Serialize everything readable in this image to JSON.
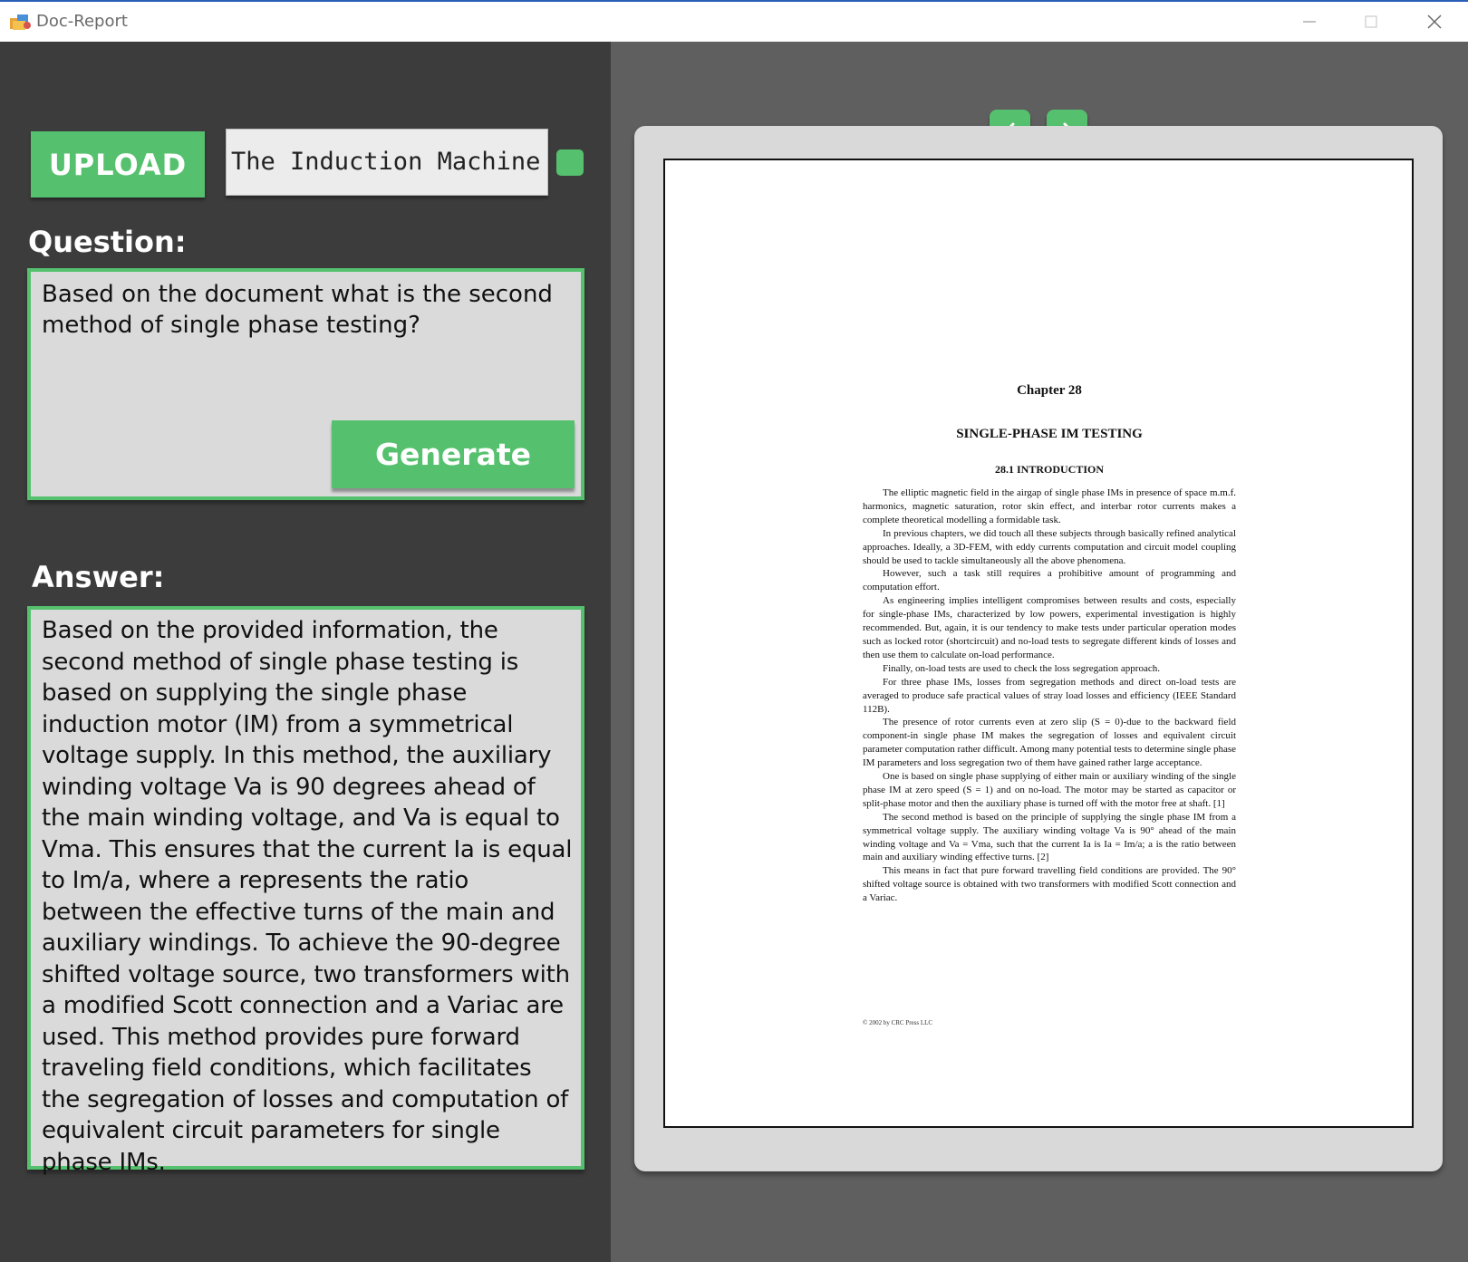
{
  "window": {
    "title": "Doc-Report"
  },
  "upload": {
    "label": "UPLOAD",
    "filename": "The Induction Machine H"
  },
  "question": {
    "label": "Question:",
    "text": "Based on the document what is the second method of single phase testing?",
    "generate_label": "Generate"
  },
  "answer": {
    "label": "Answer:",
    "text": "Based on the provided information, the second method of single phase testing is based on supplying the single phase induction motor (IM) from a symmetrical voltage supply. In this method, the auxiliary winding voltage Va is 90 degrees ahead of the main winding voltage, and Va is equal to Vma. This ensures that the current Ia is equal to Im/a, where a represents the ratio between the effective turns of the main and auxiliary windings. To achieve the 90-degree shifted voltage source, two transformers with a modified Scott connection and a Variac are used. This method provides pure forward traveling field conditions, which facilitates the segregation of losses and computation of equivalent circuit parameters for single phase IMs."
  },
  "document": {
    "chapter": "Chapter 28",
    "title": "SINGLE-PHASE IM TESTING",
    "section": "28.1 INTRODUCTION",
    "paragraphs": [
      "The elliptic magnetic field in the airgap of single phase IMs in presence of space m.m.f. harmonics, magnetic saturation, rotor skin effect, and interbar rotor currents makes a complete theoretical modelling a formidable task.",
      "In previous chapters, we did touch all these subjects through basically refined analytical approaches. Ideally, a 3D-FEM, with eddy currents computation and circuit model coupling should be used to tackle simultaneously all the above phenomena.",
      "However, such a task still requires a prohibitive amount of programming and computation effort.",
      "As engineering implies intelligent compromises between results and costs, especially for single-phase IMs, characterized by low powers, experimental investigation is highly recommended. But, again, it is our tendency to make tests under particular operation modes such as locked rotor (shortcircuit) and no-load tests to segregate different kinds of losses and then use them to calculate on-load performance.",
      "Finally, on-load tests are used to check the loss segregation approach.",
      "For three phase IMs, losses from segregation methods and direct on-load tests are averaged to produce safe practical values of stray load losses and efficiency (IEEE Standard 112B).",
      "The presence of rotor currents even at zero slip (S = 0)-due to the backward field component-in single phase IM makes the segregation of losses and equivalent circuit parameter computation rather difficult. Among many potential tests to determine single phase IM parameters and loss segregation two of them have gained rather large acceptance.",
      "One is based on single phase supplying of either main or auxiliary winding of the single phase IM at zero speed (S = 1) and on no-load. The motor may be started as capacitor or split-phase motor and then the auxiliary phase is turned off with the motor free at shaft. [1]",
      "The second method is based on the principle of supplying the single phase IM from a symmetrical voltage supply. The auxiliary winding voltage Va is 90° ahead of the main winding voltage and Va = Vma, such that the current Ia is Ia = Im/a; a is the ratio between main and auxiliary winding effective turns. [2]",
      "This means in fact that pure forward travelling field conditions are provided. The 90° shifted voltage source is obtained with two transformers with modified Scott connection and a Variac."
    ],
    "footer": "© 2002 by CRC Press LLC"
  }
}
